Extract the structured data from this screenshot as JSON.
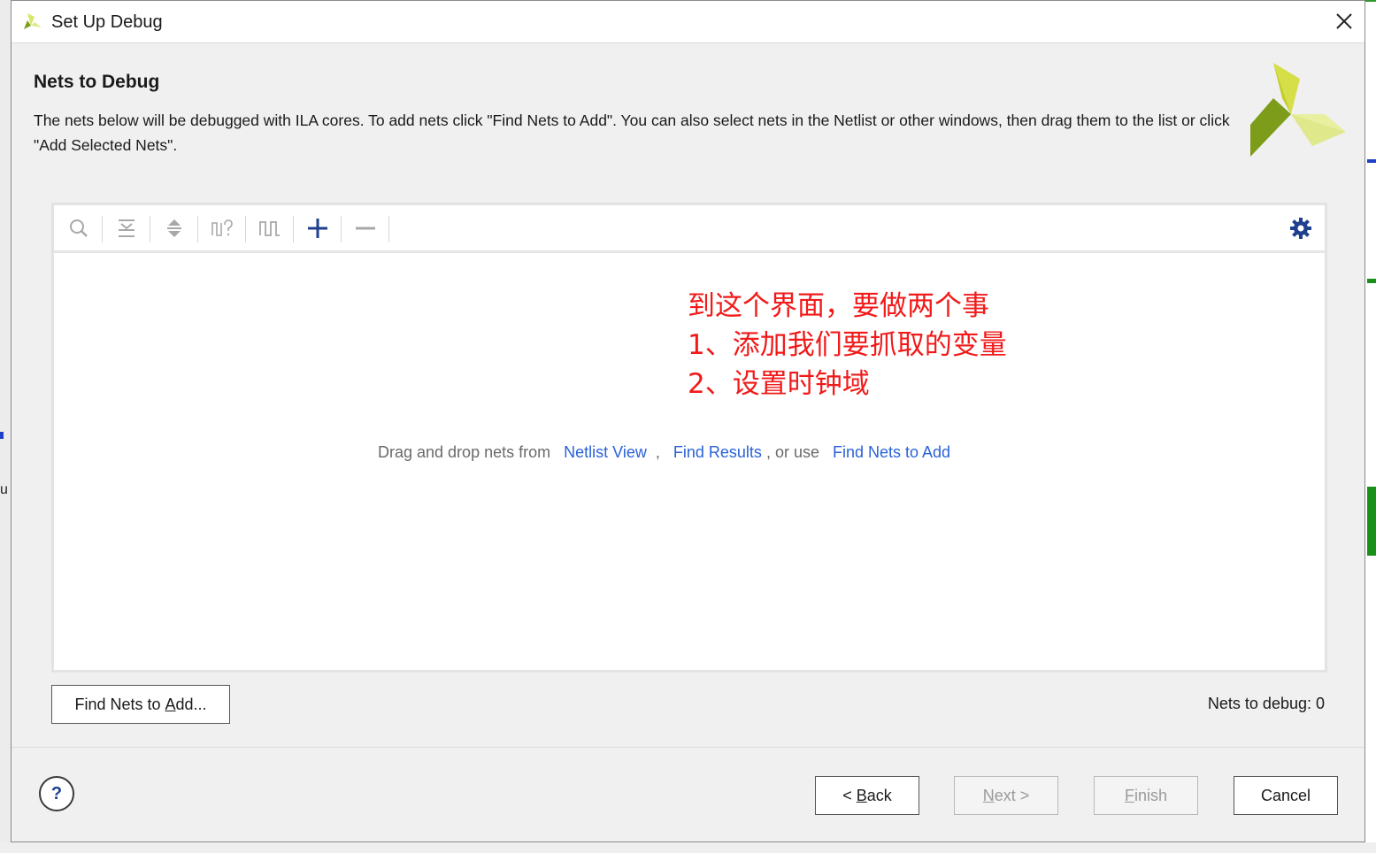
{
  "window": {
    "title": "Set Up Debug"
  },
  "page": {
    "heading": "Nets to Debug",
    "description": "The nets below will be debugged with ILA cores. To add nets click \"Find Nets to Add\". You can also select nets in the Netlist or other windows, then drag them to the list or click \"Add Selected Nets\"."
  },
  "toolbar": {
    "buttons": [
      {
        "name": "search-icon",
        "enabled": false
      },
      {
        "name": "collapse-all-icon",
        "enabled": false
      },
      {
        "name": "expand-all-icon",
        "enabled": false
      },
      {
        "name": "probe-type-icon",
        "enabled": false
      },
      {
        "name": "clock-domain-icon",
        "enabled": false
      },
      {
        "name": "plus-icon",
        "enabled": true
      },
      {
        "name": "minus-icon",
        "enabled": false
      }
    ],
    "settings_icon": "gear-icon"
  },
  "list": {
    "hint_prefix": "Drag and drop nets from",
    "link_netlist": "Netlist View",
    "comma": ",",
    "link_find_results": "Find Results",
    "or_use": ", or use",
    "link_find_nets": "Find Nets to Add"
  },
  "annotation": {
    "line1": "到这个界面，要做两个事",
    "line2": "1、添加我们要抓取的变量",
    "line3": "2、设置时钟域"
  },
  "actions": {
    "find_nets_button_prefix": "Find Nets to ",
    "find_nets_button_mnemonic": "A",
    "find_nets_button_suffix": "dd...",
    "nets_count_label": "Nets to debug: 0"
  },
  "footer": {
    "help_label": "?",
    "back_prefix": "< ",
    "back_mnemonic": "B",
    "back_suffix": "ack",
    "next_mnemonic": "N",
    "next_suffix": "ext >",
    "finish_mnemonic": "F",
    "finish_suffix": "inish",
    "cancel_label": "Cancel"
  },
  "colors": {
    "link": "#2a62d8",
    "annotation": "#f11a1a",
    "logo_light": "#d9e66a",
    "logo_dark": "#7c9c1a"
  }
}
